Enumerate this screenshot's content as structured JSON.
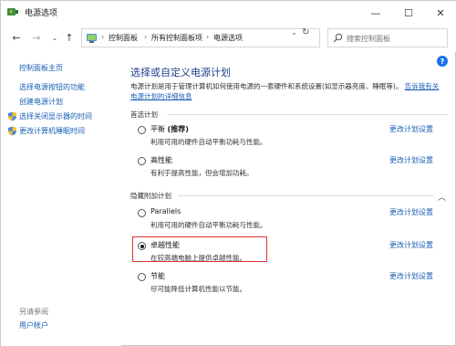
{
  "window": {
    "title": "电源选项"
  },
  "controls": {
    "minimize": "—",
    "maximize": "☐",
    "close": "✕"
  },
  "nav": {
    "back": "←",
    "forward": "→",
    "dropdown": "⌄",
    "up": "↑",
    "refresh": "↻"
  },
  "breadcrumbs": [
    "控制面板",
    "所有控制面板项",
    "电源选项"
  ],
  "search": {
    "placeholder": "搜索控制面板"
  },
  "sidebar": {
    "home": "控制面板主页",
    "items": [
      "选择电源按钮的功能",
      "创建电源计划",
      "选择关闭显示器的时间",
      "更改计算机睡眠时间"
    ],
    "see_also_label": "另请参阅",
    "user_accounts": "用户帐户"
  },
  "main": {
    "help": "?",
    "title": "选择或自定义电源计划",
    "description": "电源计划是用于管理计算机如何使用电源的一套硬件和系统设置(如显示器亮度、睡眠等)。",
    "description_link": "告诉我有关电源计划的详细信息",
    "preferred_label": "首选计划",
    "hidden_label": "隐藏附加计划",
    "change_settings": "更改计划设置",
    "plans": [
      {
        "name": "平衡",
        "suffix": "(推荐)",
        "desc": "利用可用的硬件自动平衡功耗与性能。",
        "checked": false
      },
      {
        "name": "高性能",
        "suffix": "",
        "desc": "有利于提高性能，但会增加功耗。",
        "checked": false
      },
      {
        "name": "Parallels",
        "suffix": "",
        "desc": "利用可用的硬件自动平衡功耗与性能。",
        "checked": false
      },
      {
        "name": "卓越性能",
        "suffix": "",
        "desc": "在较高端电脑上提供卓越性能。",
        "checked": true
      },
      {
        "name": "节能",
        "suffix": "",
        "desc": "尽可能降低计算机性能以节能。",
        "checked": false
      }
    ]
  },
  "colors": {
    "link": "#1a5fb4",
    "title": "#1e3f8a",
    "highlight": "#e0302e"
  }
}
